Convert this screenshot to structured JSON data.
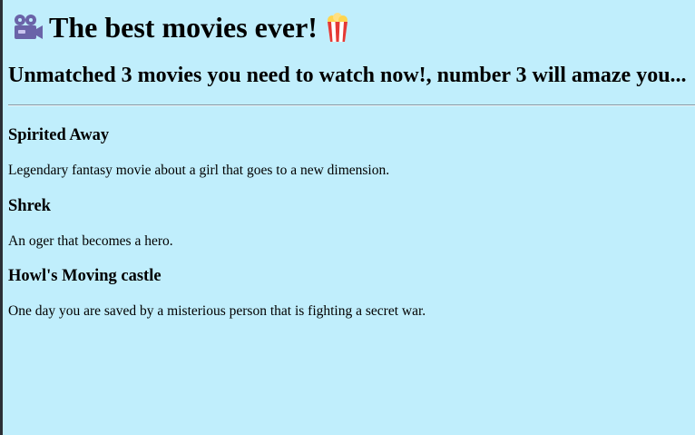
{
  "header": {
    "title": "The best movies ever!",
    "subtitle": "Unmatched 3 movies you need to watch now!, number 3 will amaze you...",
    "leading_icon": "movie-camera-icon",
    "trailing_icon": "popcorn-icon"
  },
  "colors": {
    "page_background": "#c0eefc",
    "window_frame": "#2b2f36",
    "camera_icon": "#6a63a8",
    "popcorn_red": "#e53935",
    "popcorn_corn": "#ffd54f"
  },
  "movies": [
    {
      "title": "Spirited Away",
      "description": "Legendary fantasy movie about a girl that goes to a new dimension."
    },
    {
      "title": "Shrek",
      "description": "An oger that becomes a hero."
    },
    {
      "title": "Howl's Moving castle",
      "description": "One day you are saved by a misterious person that is fighting a secret war."
    }
  ]
}
